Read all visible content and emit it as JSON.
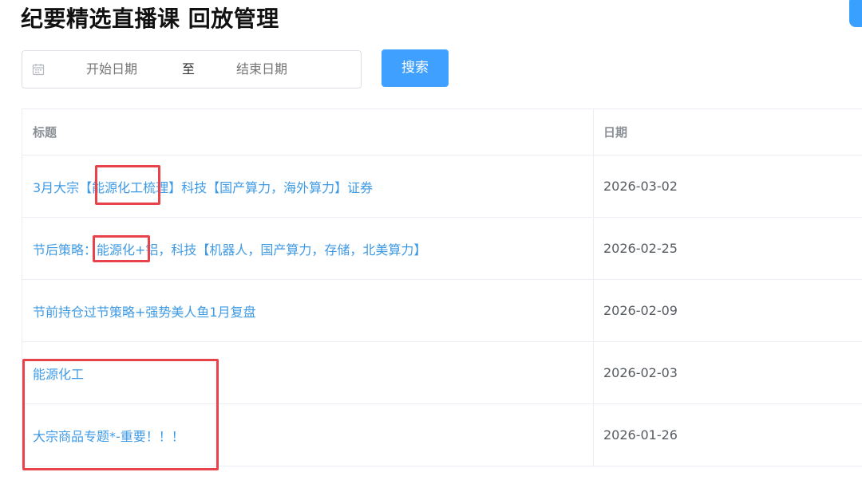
{
  "page": {
    "title": "纪要精选直播课 回放管理"
  },
  "filter": {
    "start_placeholder": "开始日期",
    "separator": "至",
    "end_placeholder": "结束日期",
    "search_label": "搜索"
  },
  "table": {
    "headers": [
      "标题",
      "日期"
    ],
    "rows": [
      {
        "title": "3月大宗【能源化工梳理】科技【国产算力，海外算力】证券",
        "date": "2026-03-02"
      },
      {
        "title": "节后策略：能源化+铝，科技【机器人，国产算力，存储，北美算力】",
        "date": "2026-02-25"
      },
      {
        "title": "节前持仓过节策略+强势美人鱼1月复盘",
        "date": "2026-02-09"
      },
      {
        "title": "能源化工",
        "date": "2026-02-03"
      },
      {
        "title": "大宗商品专题*-重要！！！",
        "date": "2026-01-26"
      }
    ]
  },
  "colors": {
    "accent": "#40a0ff",
    "link": "#3f9ae4",
    "annotation": "#e8434b"
  },
  "icons": {
    "date_picker": "calendar-icon"
  }
}
